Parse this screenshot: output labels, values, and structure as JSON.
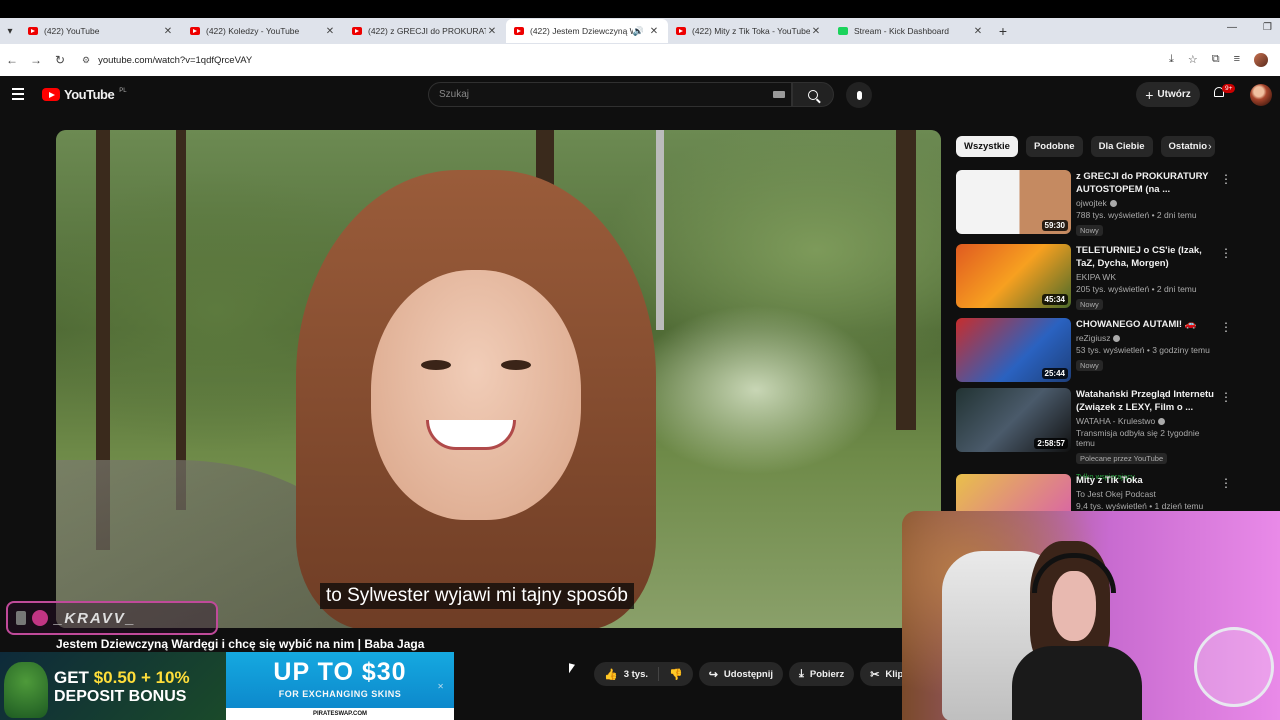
{
  "browser": {
    "tabs": [
      {
        "title": "(422) YouTube",
        "icon": "youtube-favicon",
        "active": false
      },
      {
        "title": "(422) Koledzy - YouTube",
        "icon": "youtube-favicon",
        "active": false
      },
      {
        "title": "(422) z GRECJI do PROKURATU",
        "icon": "youtube-favicon",
        "active": false
      },
      {
        "title": "(422) Jestem Dziewczyną W",
        "icon": "youtube-favicon",
        "active": true
      },
      {
        "title": "(422) Mity z Tik Toka - YouTube",
        "icon": "youtube-favicon",
        "active": false
      },
      {
        "title": "Stream - Kick Dashboard",
        "icon": "kick-favicon",
        "active": false
      }
    ],
    "url": "youtube.com/watch?v=1qdfQrceVAY"
  },
  "youtube": {
    "logo": "YouTube",
    "region": "PL",
    "search_placeholder": "Szukaj",
    "create_label": "Utwórz",
    "notifications_badge": "9+"
  },
  "video": {
    "subtitle": "to Sylwester wyjawi mi tajny sposób",
    "title": "Jestem Dziewczyną Wardęgi i chcę się wybić na nim | Baba Jaga",
    "likes": "3 tys.",
    "share_label": "Udostępnij",
    "download_label": "Pobierz",
    "clip_label": "Klip"
  },
  "overlay": {
    "handle": "_KRAVV_"
  },
  "ad": {
    "left_line1_a": "GET",
    "left_line1_b": "$0.50 + 10%",
    "left_line2": "DEPOSIT BONUS",
    "right_big": "UP TO $30",
    "right_small": "FOR EXCHANGING SKINS",
    "right_foot": "PIRATESWAP.COM"
  },
  "sidebar": {
    "chips": [
      "Wszystkie",
      "Podobne",
      "Dla Ciebie",
      "Ostatnio"
    ],
    "recommendations": [
      {
        "title": "z GRECJI do PROKURATURY AUTOSTOPEM (na ...",
        "channel": "ojwojtek",
        "meta": "788 tys. wyświetleń • 2 dni temu",
        "badge": "Nowy",
        "duration": "59:30"
      },
      {
        "title": "TELETURNIEJ o CS'ie (Izak, TaZ, Dycha, Morgen)",
        "channel": "EKIPA WK",
        "meta": "205 tys. wyświetleń • 2 dni temu",
        "badge": "Nowy",
        "duration": "45:34"
      },
      {
        "title": "CHOWANEGO AUTAMI! 🚗",
        "channel": "reZigiusz",
        "meta": "53 tys. wyświetleń • 3 godziny temu",
        "badge": "Nowy",
        "duration": "25:44"
      },
      {
        "title": "Watahański Przegląd Internetu (Związek z LEXY, Film o ...",
        "channel": "WATAHA - Krulestwo",
        "meta": "Transmisja odbyła się 2 tygodnie temu",
        "badge": "Polecane przez YouTube",
        "extra": "Tylko wspierający",
        "duration": "2:58:57"
      },
      {
        "title": "Mity z Tik Toka",
        "channel": "To Jest Okej Podcast",
        "meta": "9,4 tys. wyświetleń • 1 dzień temu"
      }
    ]
  }
}
